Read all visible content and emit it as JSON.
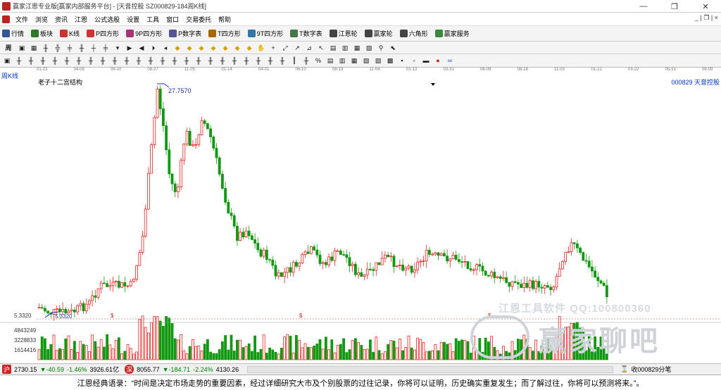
{
  "window": {
    "title": "赢家江恩专业版[赢家内部服务平台] - [天音控股  SZ000829-184周K线]",
    "controls": [
      "—",
      "❐",
      "✕"
    ]
  },
  "menu": {
    "items": [
      "文件",
      "浏览",
      "资讯",
      "江恩",
      "公式选股",
      "设置",
      "工具",
      "窗口",
      "交易委托",
      "帮助"
    ],
    "right_controls": "_ | ❐ | ×"
  },
  "toolbar": {
    "items": [
      {
        "label": "行情",
        "icon": "grid-icon",
        "color": "#335599"
      },
      {
        "label": "板块",
        "icon": "blocks-icon",
        "color": "#2a7a2a"
      },
      {
        "label": "K线",
        "icon": "candle-icon",
        "color": "#cc3333"
      },
      {
        "label": "P四方形",
        "icon": "p-square-icon",
        "color": "#cc3333"
      },
      {
        "label": "9P四方形",
        "icon": "9p-square-icon",
        "color": "#aa3377"
      },
      {
        "label": "P数字表",
        "icon": "p-table-icon",
        "color": "#555599"
      },
      {
        "label": "T四方形",
        "icon": "t-square-icon",
        "color": "#aa6600"
      },
      {
        "label": "9T四方形",
        "icon": "9t-square-icon",
        "color": "#3377aa"
      },
      {
        "label": "T数字表",
        "icon": "t-table-icon",
        "color": "#447744"
      },
      {
        "label": "江恩轮",
        "icon": "gann-wheel-icon",
        "color": "#444"
      },
      {
        "label": "赢家轮",
        "icon": "winner-wheel-icon",
        "color": "#444"
      },
      {
        "label": "六角形",
        "icon": "hexagon-icon",
        "color": "#444"
      },
      {
        "label": "赢家服务",
        "icon": "dollar-icon",
        "color": "#3a8a3a"
      }
    ]
  },
  "period_selector": "周",
  "timeline": {
    "labels": [
      "01-23",
      "04-09",
      "06-10",
      "08-27",
      "11-05",
      "01-14",
      "04-01",
      "06-10",
      "08-19",
      "11-04",
      "01-13",
      "03-31",
      "06-09",
      "08-18",
      "11-03",
      "01-12",
      "03-22",
      "05-31",
      "08-09"
    ]
  },
  "chart": {
    "period_label": "周K线",
    "study_title": "老子十二宫结构",
    "symbol_label": "000829  天音控股",
    "high_label": "27.7570",
    "low_label": "5.3320",
    "low_axis_label": "5.3320",
    "volume_axis_labels": [
      "4843249",
      "3228833",
      "1614416"
    ],
    "marker_symbol": "$",
    "colors": {
      "up": "#ee2222",
      "down": "#119911",
      "high_marker": "#2233aa"
    }
  },
  "chart_data": {
    "type": "candlestick",
    "title": "老子十二宫结构",
    "series": [
      {
        "name": "price",
        "ylim": [
          5,
          28
        ],
        "annotations": {
          "high": 27.757,
          "low": 5.332
        }
      }
    ]
  },
  "status": {
    "index1_icon": "沪",
    "index1": "2730.15",
    "index1_change": "▼-40.59",
    "index1_pct": "-1.46%",
    "index1_vol": "3926.61亿",
    "index2_icon": "深",
    "index2": "8055.77",
    "index2_change": "▼-184.71",
    "index2_pct": "-2.24%",
    "index2_vol": "4130.26",
    "right_label": "收000829分笔"
  },
  "watermark": {
    "line1": "江恩工具软件  QQ:100800360",
    "line2": "赢家聊吧"
  },
  "quote": "江恩经典语录：“时间是决定市场走势的重要因素，经过详细研究大市及个别股票的过往记录，你将可以证明，历史确实重复发生；而了解过往，你将可以预测将来。”。"
}
